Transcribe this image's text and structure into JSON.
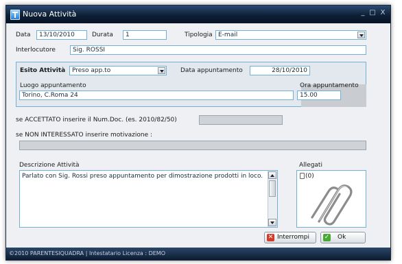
{
  "window": {
    "title": "Nuova Attività",
    "controls": [
      "_",
      "□",
      "X"
    ]
  },
  "fields": {
    "data_label": "Data",
    "data_value": "13/10/2010",
    "durata_label": "Durata",
    "durata_value": "1",
    "tipologia_label": "Tipologia",
    "tipologia_value": "E-mail",
    "interlocutore_label": "Interlocutore",
    "interlocutore_value": "Sig. ROSSI"
  },
  "esito": {
    "esito_label": "Esito Attività",
    "esito_value": "Preso app.to",
    "data_app_label": "Data appuntamento",
    "data_app_value": "28/10/2010",
    "luogo_label": "Luogo appuntamento",
    "luogo_value": "Torino, C.Roma 24",
    "ora_label": "Ora appuntamento",
    "ora_value": "15.00"
  },
  "accettato_label": "se ACCETTATO inserire il Num.Doc. (es. 2010/82/50)",
  "non_interessato_label": "se NON INTERESSATO inserire motivazione :",
  "descrizione": {
    "label": "Descrizione Attività",
    "text": "Parlato con Sig. Rossi preso appuntamento per dimostrazione prodotti in loco."
  },
  "allegati": {
    "label": "Allegati",
    "count": "(0)"
  },
  "buttons": {
    "interrompi": "Interrompi",
    "ok": "Ok"
  },
  "status_bar": "©2010 PARENTESIQUADRA | Intestatario Licenza : DEMO",
  "colors": {
    "titlebar": "#0e1f36",
    "field_border": "#6fb0d6",
    "cancel_icon": "#d23a2a",
    "ok_icon": "#49a935"
  }
}
